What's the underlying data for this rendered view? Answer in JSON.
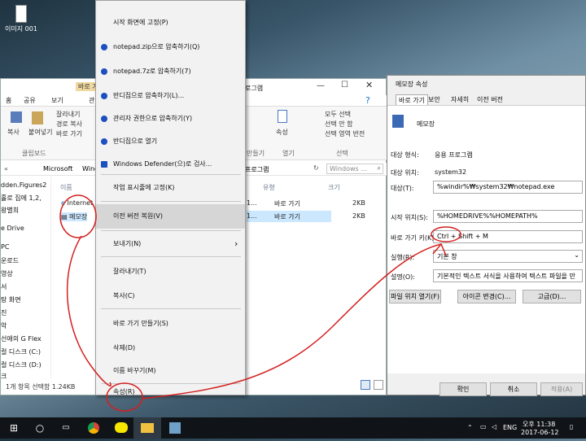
{
  "desktop": {
    "icon_label": "이미지 001"
  },
  "explorer": {
    "title_fragment": "바로 가",
    "title_suffix": "로그램",
    "tabs": [
      "홈",
      "공유",
      "보기",
      "관"
    ],
    "ribbon": {
      "pin": "복사",
      "paste": "붙여넣기",
      "cut": "잘라내기",
      "copy_path": "경로 복사",
      "paste_shortcut": "바로 가기",
      "clipboard_group": "클립보드",
      "select_all": "모두 선택",
      "select_none": "선택 안 함",
      "invert": "선택 영역 반전",
      "select_group": "선택",
      "properties": "속성",
      "open_group": "열기",
      "shortcut_group": "만들기"
    },
    "address": {
      "part1": "Microsoft",
      "part2": "Wind",
      "tail": "프로그램",
      "search_placeholder": "Windows ..."
    },
    "nav": [
      "dden.Figures2",
      "홀로 집에 1,2,",
      "왕별희",
      "e Drive",
      "PC",
      "운로드",
      "영상",
      "서",
      "탕 화면",
      "진",
      "악",
      "선애의 G Flex",
      "컬 디스크 (C:)",
      "컬 디스크 (D:)",
      "크"
    ],
    "columns": {
      "name": "이름",
      "type": "유형",
      "size": "크기"
    },
    "files": [
      {
        "name": "Internet",
        "date": "1...",
        "type": "바로 가기",
        "size": "2KB"
      },
      {
        "name": "메모장",
        "date": "1...",
        "type": "바로 가기",
        "size": "2KB"
      }
    ],
    "status": "1개 항목 선택함 1.24KB"
  },
  "context_menu": {
    "items": [
      {
        "label": "시작 화면에 고정(P)"
      },
      {
        "label": "notepad.zip으로 압축하기(Q)"
      },
      {
        "label": "notepad.7z로 압축하기(7)"
      },
      {
        "label": "반디집으로 압축하기(L)..."
      },
      {
        "label": "관리자 권한으로 압축하기(Y)"
      },
      {
        "label": "반디집으로 열기"
      },
      {
        "label": "Windows Defender(으)로 검사..."
      },
      {
        "label": "작업 표시줄에 고정(K)"
      },
      {
        "label": "이전 버전 복원(V)"
      },
      {
        "label": "보내기(N)"
      },
      {
        "label": "잘라내기(T)"
      },
      {
        "label": "복사(C)"
      },
      {
        "label": "바로 가기 만들기(S)"
      },
      {
        "label": "삭제(D)"
      },
      {
        "label": "이름 바꾸기(M)"
      },
      {
        "label": "속성(R)"
      }
    ],
    "submenu_arrow": "›"
  },
  "properties": {
    "title": "메모장 속성",
    "tabs": [
      "바로 가기",
      "보안",
      "자세히",
      "이전 버전"
    ],
    "name": "메모장",
    "labels": {
      "target_type": "대상 형식:",
      "target_location": "대상 위치:",
      "target": "대상(T):",
      "start_in": "시작 위치(S):",
      "shortcut_key": "바로 가기 키(K):",
      "run": "실행(R):",
      "comment": "설명(O):"
    },
    "values": {
      "target_type": "응용 프로그램",
      "target_location": "system32",
      "target": "%windir%₩system32₩notepad.exe",
      "start_in": "%HOMEDRIVE%%HOMEPATH%",
      "shortcut_key": "Ctrl + Shift + M",
      "run": "기본 창",
      "comment": "기본적인 텍스트 서식을 사용하여 텍스트 파일을 만"
    },
    "buttons": {
      "open_location": "파일 위치 열기(F)",
      "change_icon": "아이콘 변경(C)...",
      "advanced": "고급(D)...",
      "ok": "확인",
      "cancel": "취소",
      "apply": "적용(A)"
    }
  },
  "taskbar": {
    "time": "오후 11:38",
    "date": "2017-06-12",
    "lang": "ENG",
    "search_glyph": "○",
    "start_glyph": "⊞"
  },
  "colors": {
    "annotation": "#d42020",
    "accent": "#1c4fc0"
  }
}
